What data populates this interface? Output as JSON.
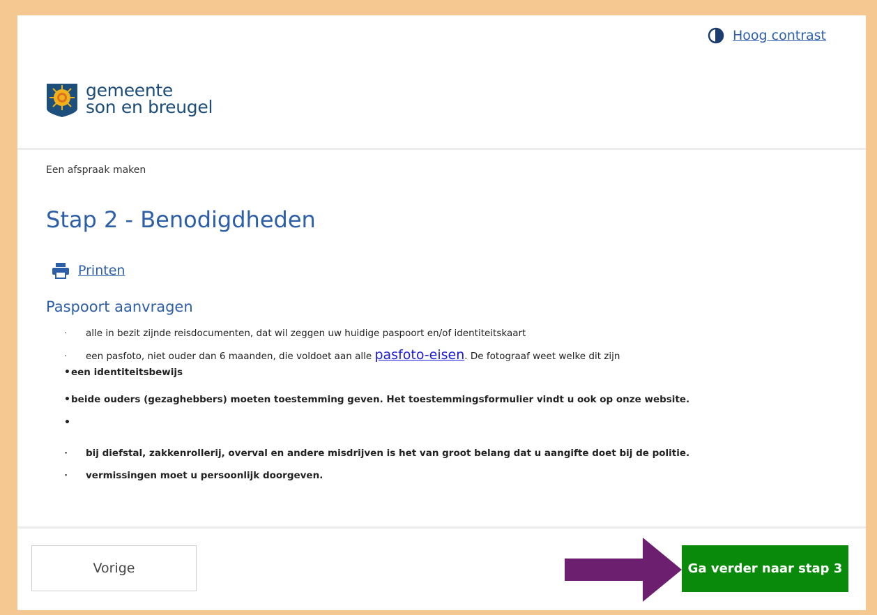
{
  "header": {
    "contrast_label": "Hoog contrast",
    "logo_line1": "gemeente",
    "logo_line2": "son en breugel"
  },
  "breadcrumb": "Een afspraak maken",
  "page_title": "Stap 2 - Benodigdheden",
  "print_label": "Printen",
  "section_title": "Paspoort aanvragen",
  "items": [
    {
      "marker": "·",
      "text": "alle in bezit zijnde reisdocumenten, dat wil zeggen uw huidige paspoort en/of identiteitskaart"
    },
    {
      "marker": "·",
      "text_before": "een pasfoto, niet ouder dan 6 maanden, die voldoet aan alle ",
      "link": "pasfoto-eisen",
      "text_after": ". De fotograaf weet welke dit zijn"
    },
    {
      "marker": "•",
      "text": "een identiteitsbewijs"
    },
    {
      "marker": "•",
      "text": "beide ouders (gezaghebbers) moeten toestemming geven. Het toestemmingsformulier vindt u ook op onze website."
    },
    {
      "marker": "•",
      "text": ""
    },
    {
      "marker": "·",
      "text": "bij diefstal, zakkenrollerij, overval en andere misdrijven is het van groot  belang dat u aangifte doet bij de politie."
    },
    {
      "marker": "·",
      "text": "vermissingen moet u persoonlijk doorgeven."
    }
  ],
  "footer": {
    "prev_label": "Vorige",
    "next_label": "Ga verder naar stap 3"
  },
  "colors": {
    "border": "#f5c891",
    "accent_blue": "#2d5ea8",
    "next_button": "#0a8a0a",
    "annotation_arrow": "#6b1f6e"
  }
}
